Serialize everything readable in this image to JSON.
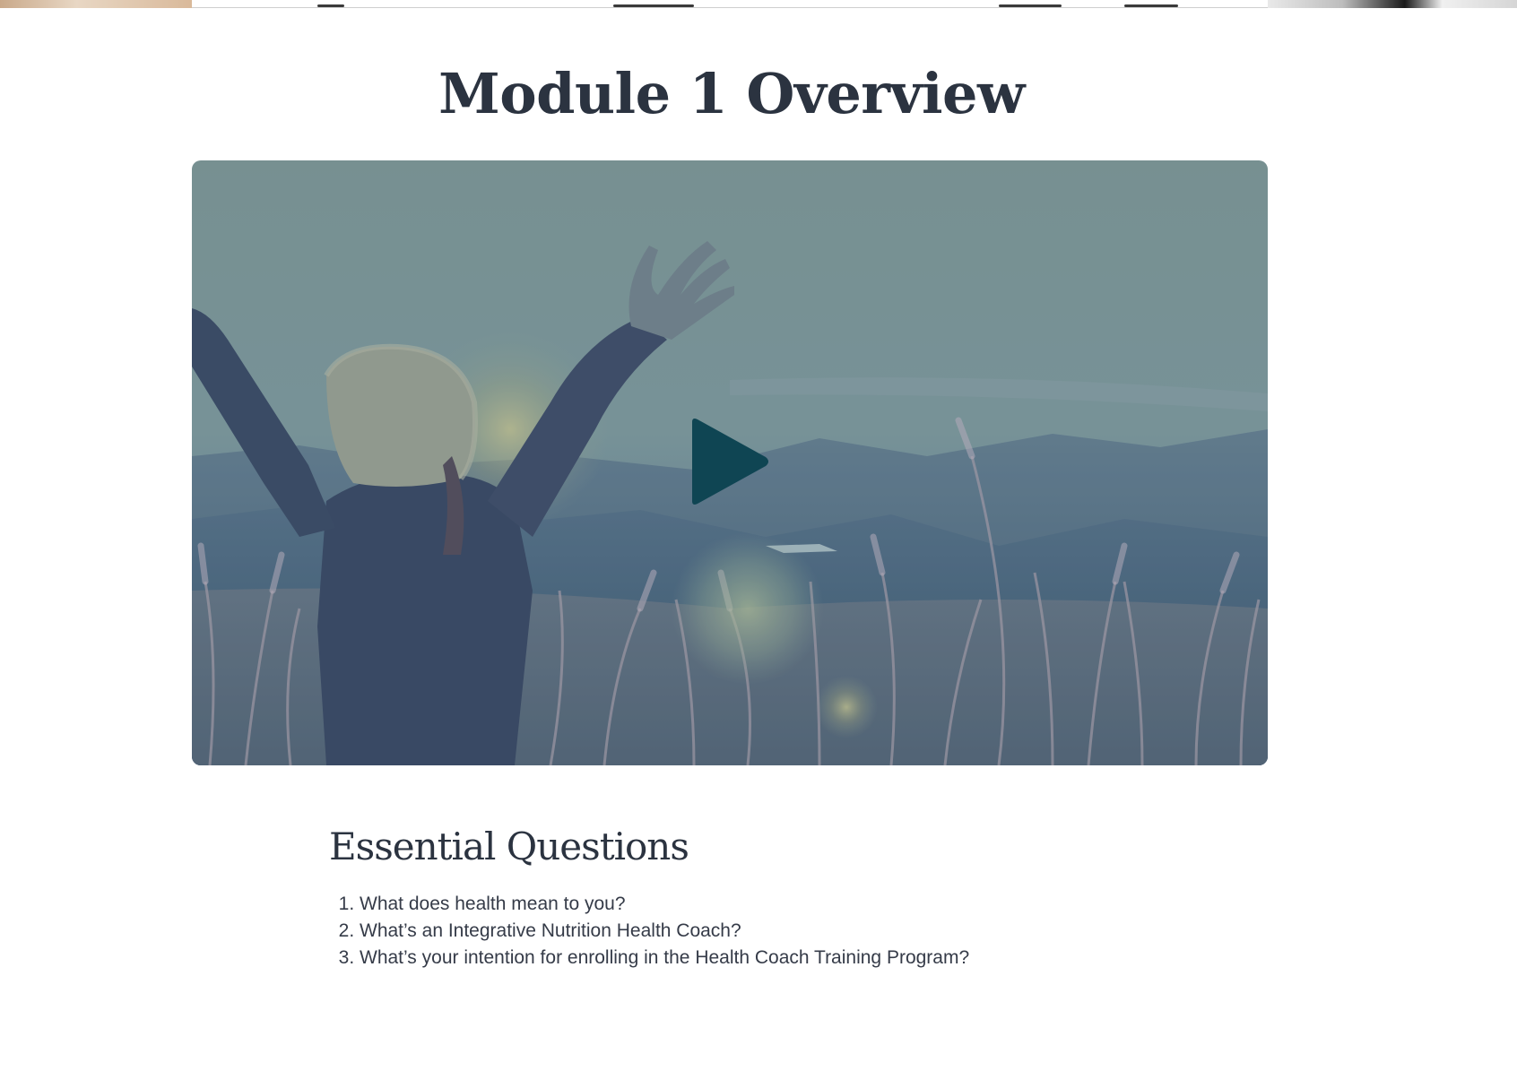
{
  "page": {
    "title": "Module 1 Overview"
  },
  "video": {
    "state": "paused",
    "overlay_color": "#0f4553"
  },
  "essential_questions": {
    "heading": "Essential Questions",
    "items": [
      "What does health mean to you?",
      "What’s an Integrative Nutrition Health Coach?",
      "What’s your intention for enrolling in the Health Coach Training Program?"
    ]
  },
  "colors": {
    "heading": "#2b3340",
    "body_text": "#353b48",
    "play_icon": "#0f4553"
  }
}
